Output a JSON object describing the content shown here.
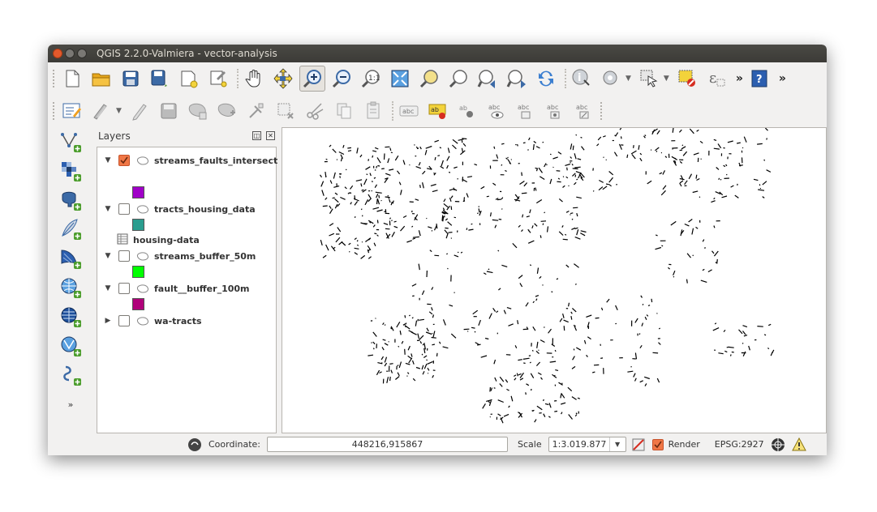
{
  "window": {
    "title": "QGIS 2.2.0-Valmiera - vector-analysis"
  },
  "toolbar_main": {
    "tools": [
      "new-project-icon",
      "open-project-icon",
      "save-project-icon",
      "save-as-icon",
      "new-print-composer-icon",
      "composer-manager-icon",
      "pan-icon",
      "pan-to-selection-icon",
      "zoom-in-icon",
      "zoom-out-icon",
      "zoom-actual-icon",
      "zoom-full-icon",
      "zoom-to-selection-icon",
      "zoom-to-layer-icon",
      "zoom-last-icon",
      "zoom-next-icon",
      "refresh-icon",
      "identify-icon",
      "action-icon",
      "select-icon",
      "deselect-icon",
      "expression-select-icon",
      "help-icon"
    ]
  },
  "toolbar_edit": {
    "tools": [
      "current-edits-icon",
      "toggle-editing-icon",
      "edit-pencil-icon",
      "save-edits-icon",
      "add-feature-icon",
      "move-feature-icon",
      "node-tool-icon",
      "delete-selected-icon",
      "cut-features-icon",
      "copy-features-icon",
      "paste-features-icon",
      "label-icon",
      "layer-labeling-icon",
      "pin-labels-icon",
      "show-hide-labels-icon",
      "move-label-icon",
      "rotate-label-icon",
      "change-label-icon"
    ]
  },
  "left_toolbar": {
    "tools": [
      "add-vector-layer-icon",
      "add-raster-layer-icon",
      "add-postgis-layer-icon",
      "add-spatialite-layer-icon",
      "add-mssql-layer-icon",
      "add-wms-layer-icon",
      "add-wcs-layer-icon",
      "add-wfs-layer-icon",
      "new-shapefile-icon"
    ]
  },
  "layers_panel": {
    "title": "Layers",
    "layers": [
      {
        "name": "streams_faults_intersect",
        "checked": true,
        "expanded": true,
        "swatch": "#a000c8"
      },
      {
        "name": "tracts_housing_data",
        "checked": false,
        "expanded": true,
        "swatch": "#2a9d8f"
      },
      {
        "name": "housing-data",
        "table": true
      },
      {
        "name": "streams_buffer_50m",
        "checked": false,
        "expanded": true,
        "swatch": "#00ff00"
      },
      {
        "name": "fault__buffer_100m",
        "checked": false,
        "expanded": true,
        "swatch": "#b0007a"
      },
      {
        "name": "wa-tracts",
        "checked": false,
        "expanded": false
      }
    ]
  },
  "statusbar": {
    "coordinate_label": "Coordinate:",
    "coordinate_value": "448216,915867",
    "scale_label": "Scale",
    "scale_value": "1:3.019.877",
    "render_label": "Render",
    "render_checked": true,
    "crs": "EPSG:2927"
  },
  "colors": {
    "checkbox_checked": "#f07746",
    "title_bar": "#3c3b37"
  }
}
